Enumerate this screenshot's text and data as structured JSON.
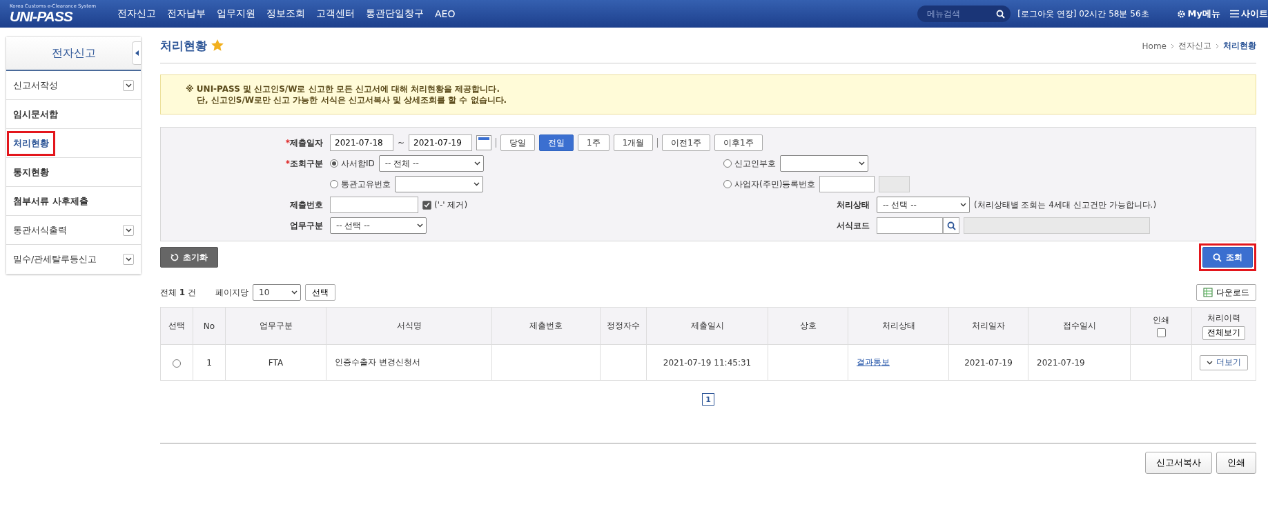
{
  "header": {
    "logo": {
      "tagline": "Korea Customs e-Clearance System",
      "title": "UNI-PASS"
    },
    "menu": [
      "전자신고",
      "전자납부",
      "업무지원",
      "정보조회",
      "고객센터",
      "통관단일창구",
      "AEO"
    ],
    "search": {
      "placeholder": "메뉴검색"
    },
    "session": "[로그아웃 연장] 02시간 58분 56초",
    "my_menu": "My메뉴",
    "sitemap": "사이트"
  },
  "sidebar": {
    "title": "전자신고",
    "items": [
      {
        "label": "신고서작성",
        "bold": false,
        "expandable": true,
        "selected": false,
        "highlighted": false
      },
      {
        "label": "임시문서함",
        "bold": true,
        "expandable": false,
        "selected": false,
        "highlighted": false
      },
      {
        "label": "처리현황",
        "bold": true,
        "expandable": false,
        "selected": true,
        "highlighted": true
      },
      {
        "label": "통지현황",
        "bold": true,
        "expandable": false,
        "selected": false,
        "highlighted": false
      },
      {
        "label": "첨부서류 사후제출",
        "bold": true,
        "expandable": false,
        "selected": false,
        "highlighted": false
      },
      {
        "label": "통관서식출력",
        "bold": false,
        "expandable": true,
        "selected": false,
        "highlighted": false
      },
      {
        "label": "밀수/관세탈루등신고",
        "bold": false,
        "expandable": true,
        "selected": false,
        "highlighted": false
      }
    ]
  },
  "page": {
    "title": "처리현황",
    "starred": true,
    "breadcrumb": [
      "Home",
      "전자신고",
      "처리현황"
    ]
  },
  "notice": [
    "※ UNI-PASS 및 신고인S/W로 신고한 모든 신고서에 대해 처리현황을 제공합니다.",
    "단, 신고인S/W로만 신고 가능한 서식은 신고서복사 및 상세조회를 할 수 없습니다."
  ],
  "form": {
    "submit_date": {
      "label": "제출일자",
      "marker": "*",
      "from": "2021-07-18",
      "separator": "~",
      "to": "2021-07-19",
      "periods": [
        {
          "label": "당일",
          "selected": false
        },
        {
          "label": "전일",
          "selected": true
        },
        {
          "label": "1주",
          "selected": false
        },
        {
          "label": "1개월",
          "selected": false
        },
        {
          "label": "이전1주",
          "selected": false
        },
        {
          "label": "이후1주",
          "selected": false
        }
      ]
    },
    "query_type": {
      "label": "조회구분",
      "marker": "*",
      "options": [
        {
          "label": "사서함ID",
          "selected": true,
          "kind": "select",
          "value": "-- 전체 --"
        },
        {
          "label": "신고인부호",
          "selected": false,
          "kind": "select"
        },
        {
          "label": "통관고유번호",
          "selected": false,
          "kind": "select"
        },
        {
          "label": "사업자(주민)등록번호",
          "selected": false,
          "kind": "input"
        }
      ]
    },
    "submit_no": {
      "label": "제출번호",
      "checkbox": {
        "label": "('-' 제거)",
        "checked": true
      }
    },
    "status": {
      "label": "처리상태",
      "value": "-- 선택 --",
      "note": "(처리상태별 조회는 4세대 신고건만 가능합니다.)"
    },
    "work_type": {
      "label": "업무구분",
      "value": "-- 선택 --"
    },
    "form_code": {
      "label": "서식코드"
    }
  },
  "actions": {
    "reset": "초기화",
    "search": {
      "label": "조회",
      "highlighted": true
    }
  },
  "summary": {
    "total": "전체 **1** 건",
    "per_page_label": "페이지당",
    "per_page": "10",
    "apply": "선택",
    "download": "다운로드"
  },
  "table": {
    "columns": [
      "선택",
      "No",
      "업무구분",
      "서식명",
      "제출번호",
      "정정자수",
      "제출일시",
      "상호",
      "처리상태",
      "처리일자",
      "접수일시",
      "인쇄",
      "처리이력"
    ],
    "print_all": {
      "checked": false
    },
    "history_all": "전체보기",
    "rows": [
      {
        "selected": false,
        "no": "1",
        "work_type": "FTA",
        "form_name": "인증수출자 변경신청서",
        "submitted_at": "2021-07-19 11:45:31",
        "status": "결과통보",
        "processed_date": "2021-07-19",
        "received_date": "2021-07-19",
        "more": "더보기"
      }
    ]
  },
  "pagination": [
    {
      "label": "1",
      "selected": true
    }
  ],
  "footer_buttons": [
    "신고서복사",
    "인쇄"
  ]
}
